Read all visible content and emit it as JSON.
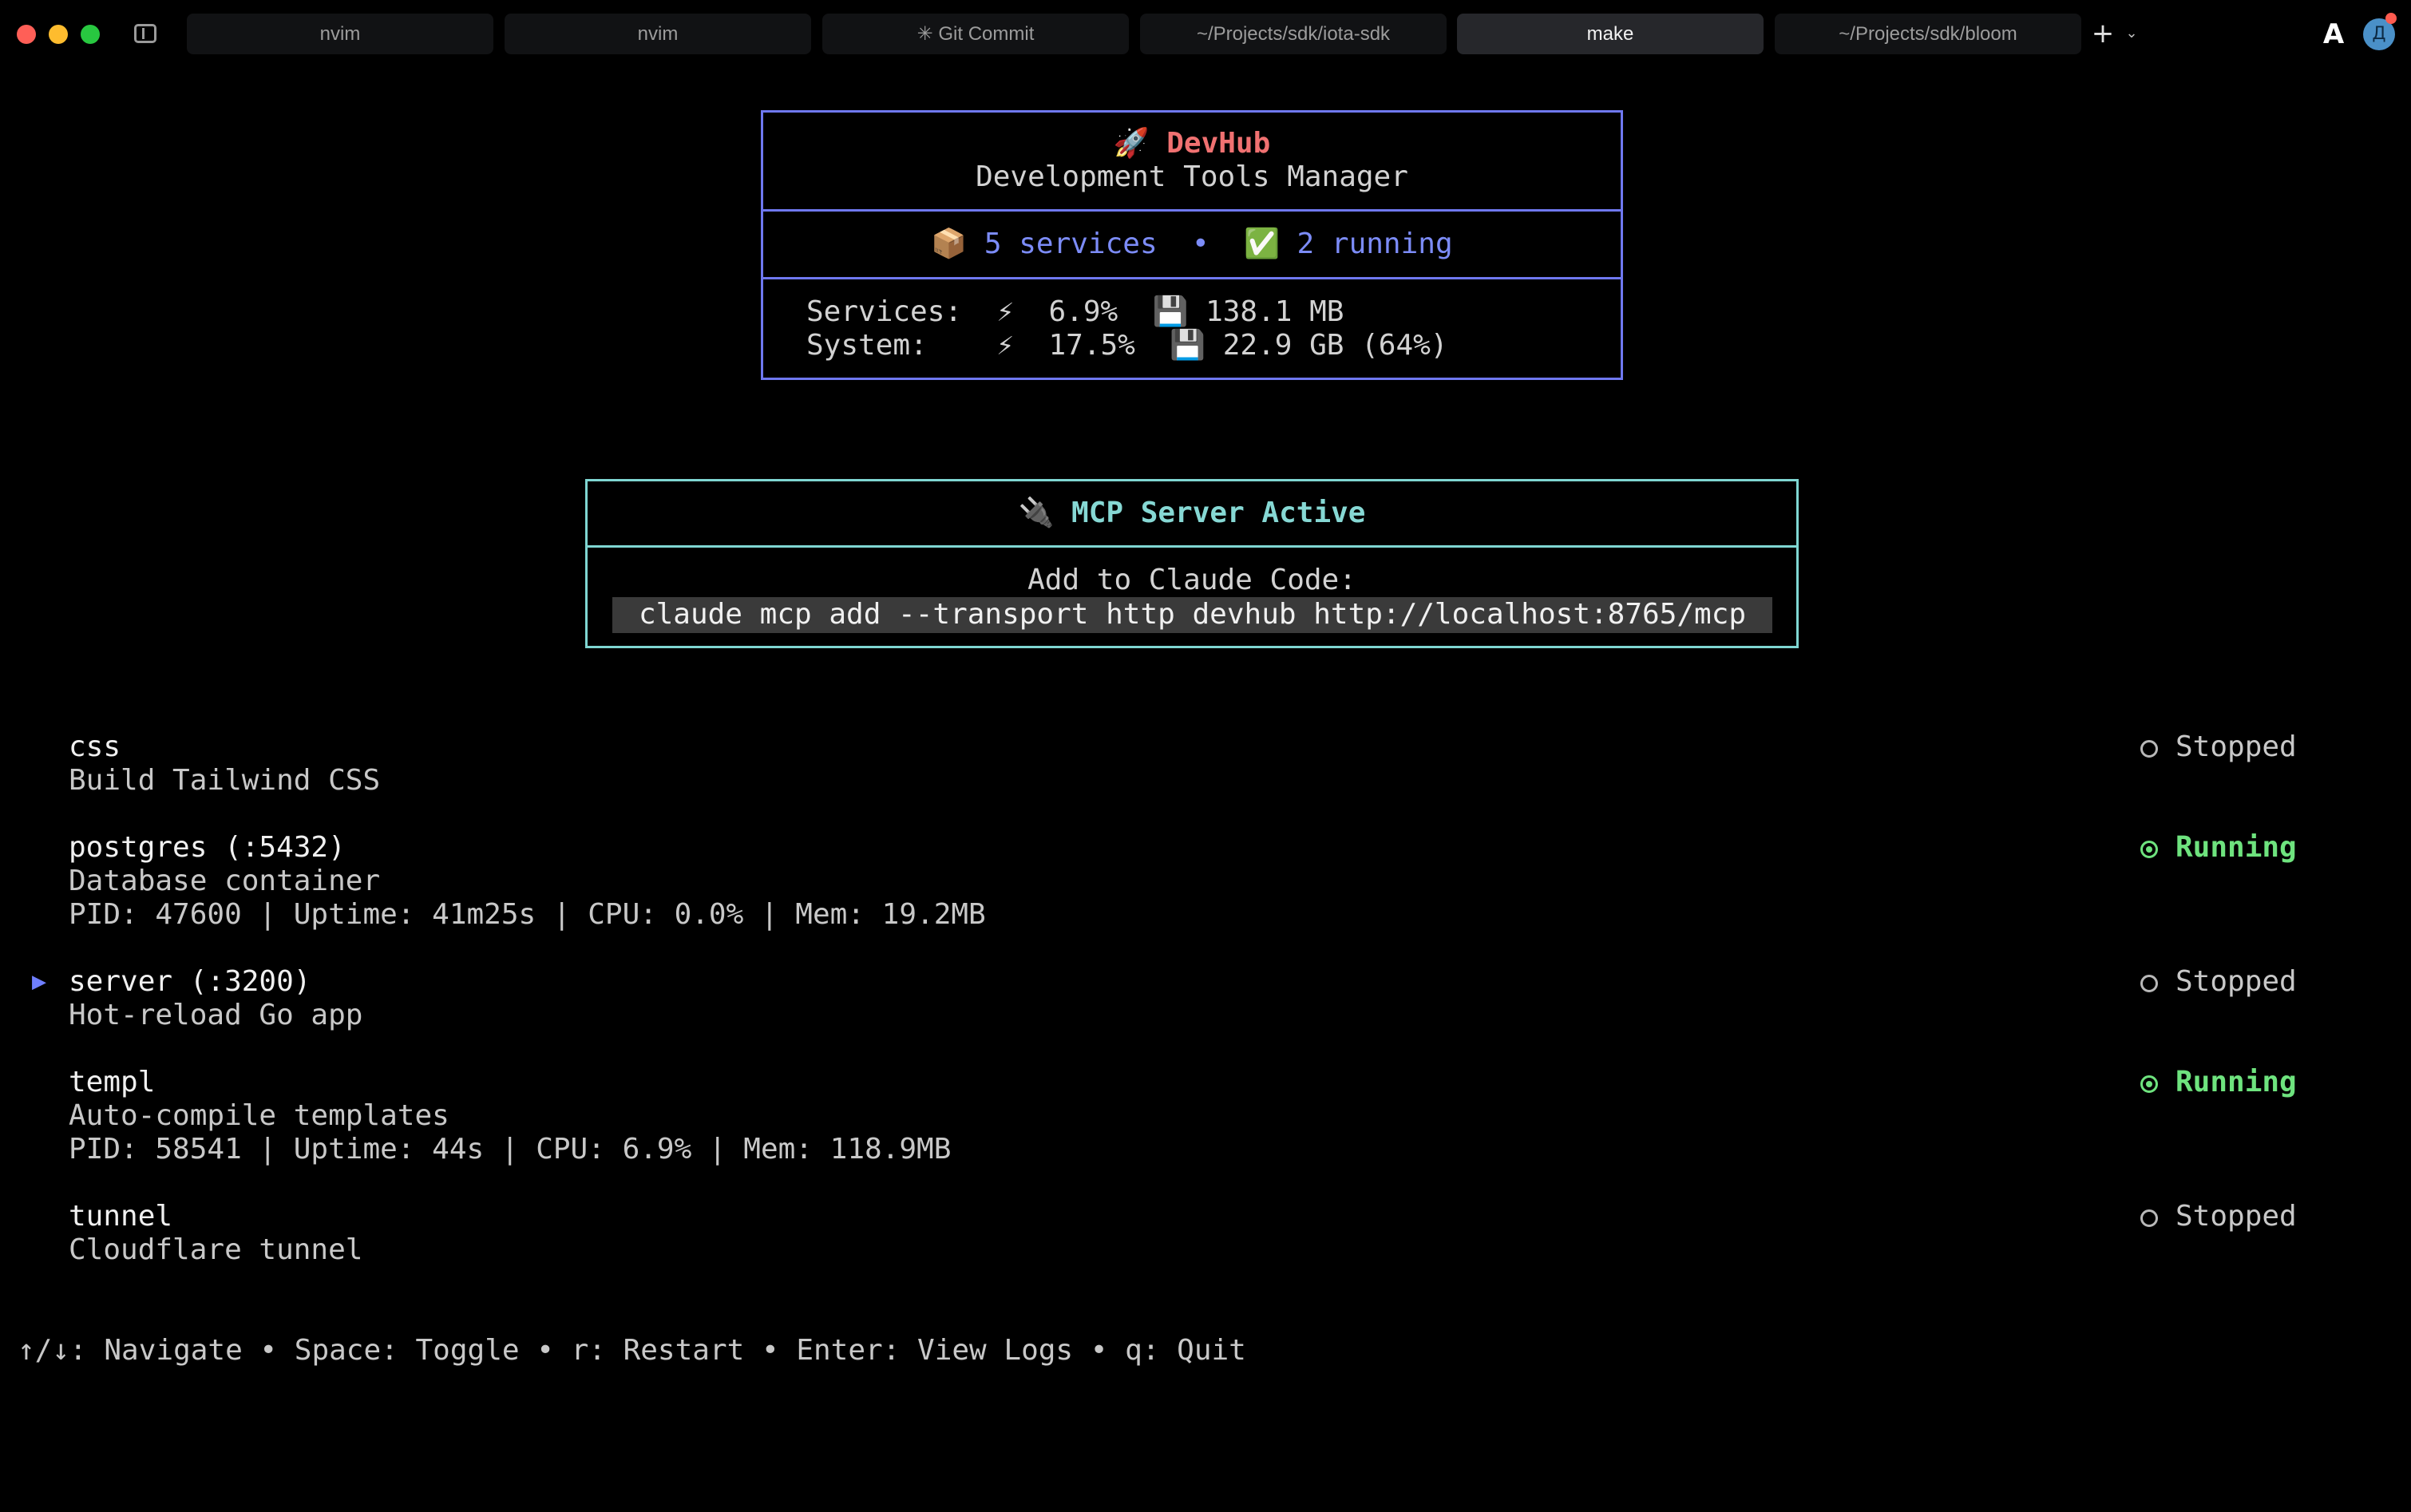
{
  "tabs": [
    {
      "label": "nvim",
      "active": false
    },
    {
      "label": "nvim",
      "active": false
    },
    {
      "label": "✳ Git Commit",
      "active": false
    },
    {
      "label": "~/Projects/sdk/iota-sdk",
      "active": false
    },
    {
      "label": "make",
      "active": true
    },
    {
      "label": "~/Projects/sdk/bloom",
      "active": false
    }
  ],
  "titlebar": {
    "new_tab_icon": "plus-icon",
    "tab_menu_icon": "chevron-down-icon",
    "app_icon": "A",
    "avatar_initial": "Д"
  },
  "header": {
    "rocket": "🚀",
    "title": "DevHub",
    "subtitle": "Development Tools Manager",
    "box_icon": "📦",
    "services_count": "5 services",
    "bullet": "•",
    "check_icon": "✅",
    "running_count": "2 running",
    "stats": [
      {
        "label": "Services:",
        "cpu_icon": "⚡",
        "cpu": "6.9%",
        "mem_icon": "💾",
        "mem": "138.1 MB"
      },
      {
        "label": "System:",
        "cpu_icon": "⚡",
        "cpu": "17.5%",
        "mem_icon": "💾",
        "mem": "22.9 GB (64%)"
      }
    ]
  },
  "mcp": {
    "plug": "🔌",
    "title": "MCP Server Active",
    "hint": "Add to Claude Code:",
    "command": "claude mcp add --transport http devhub http://localhost:8765/mcp"
  },
  "services": [
    {
      "name": "css",
      "description": "Build Tailwind CSS",
      "details": "",
      "status": "Stopped",
      "selected": false
    },
    {
      "name": "postgres (:5432)",
      "description": "Database container",
      "details": "PID: 47600 | Uptime: 41m25s | CPU: 0.0% | Mem: 19.2MB",
      "status": "Running",
      "selected": false
    },
    {
      "name": "server (:3200)",
      "description": "Hot-reload Go app",
      "details": "",
      "status": "Stopped",
      "selected": true
    },
    {
      "name": "templ",
      "description": "Auto-compile templates",
      "details": "PID: 58541 | Uptime: 44s | CPU: 6.9% | Mem: 118.9MB",
      "status": "Running",
      "selected": false
    },
    {
      "name": "tunnel",
      "description": "Cloudflare tunnel",
      "details": "",
      "status": "Stopped",
      "selected": false
    }
  ],
  "selection_marker": "▶",
  "help": "↑/↓: Navigate • Space: Toggle • r: Restart • Enter: View Logs • q: Quit",
  "colors": {
    "devhub_border": "#6f78f0",
    "mcp_border": "#7fd6d2",
    "title_coral": "#f07171",
    "running_green": "#6ee37e",
    "accent_blue": "#7c8cf8"
  }
}
